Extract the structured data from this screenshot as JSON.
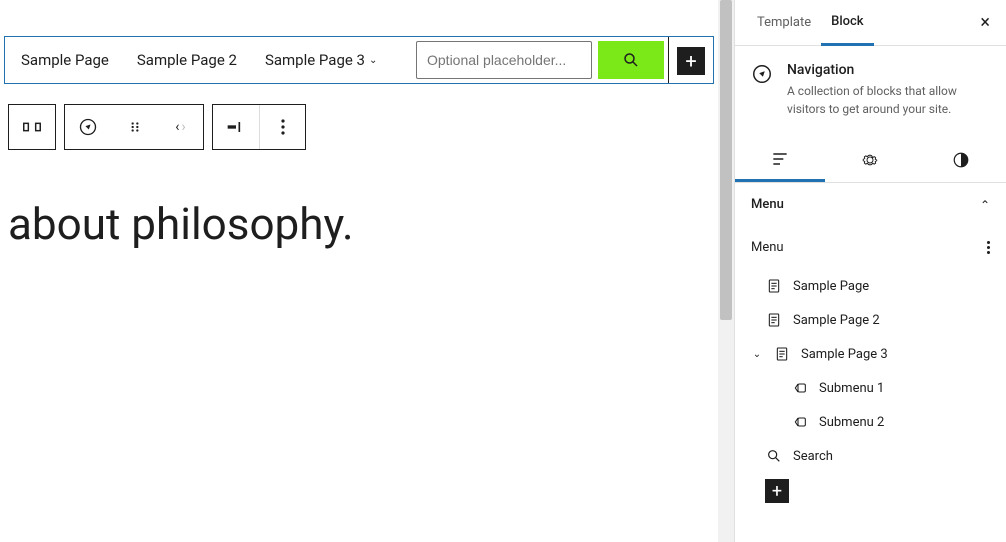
{
  "canvas": {
    "nav": {
      "items": [
        {
          "label": "Sample Page",
          "has_submenu": false
        },
        {
          "label": "Sample Page 2",
          "has_submenu": false
        },
        {
          "label": "Sample Page 3",
          "has_submenu": true
        }
      ],
      "search_placeholder": "Optional placeholder...",
      "search_button_color": "#7be817"
    },
    "heading": "about philosophy."
  },
  "sidebar": {
    "tabs": {
      "template": "Template",
      "block": "Block",
      "active": "block"
    },
    "block_header": {
      "title": "Navigation",
      "description": "A collection of blocks that allow visitors to get around your site."
    },
    "subtabs_active": "list",
    "menu_panel": {
      "header": "Menu",
      "subheader": "Menu",
      "items": [
        {
          "type": "page",
          "label": "Sample Page",
          "level": 0
        },
        {
          "type": "page",
          "label": "Sample Page 2",
          "level": 0
        },
        {
          "type": "page",
          "label": "Sample Page 3",
          "level": 0,
          "expanded": true
        },
        {
          "type": "submenu",
          "label": "Submenu 1",
          "level": 1
        },
        {
          "type": "submenu",
          "label": "Submenu 2",
          "level": 1
        },
        {
          "type": "search",
          "label": "Search",
          "level": 0
        }
      ]
    }
  }
}
